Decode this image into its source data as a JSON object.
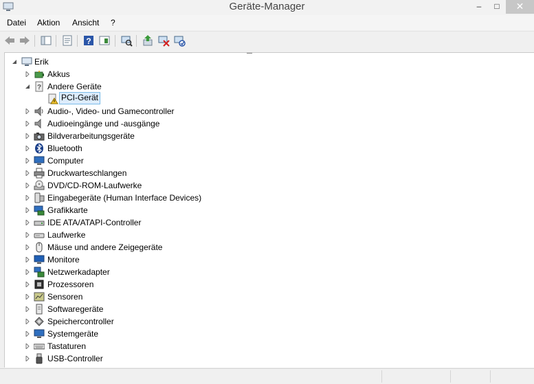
{
  "window": {
    "title": "Geräte-Manager",
    "minimize": "–",
    "maximize": "□",
    "close": "✕"
  },
  "menu": [
    "Datei",
    "Aktion",
    "Ansicht",
    "?"
  ],
  "tree": {
    "root": "Erik",
    "categories": [
      {
        "label": "Akkus",
        "icon": "battery-icon",
        "expanded": false
      },
      {
        "label": "Andere Geräte",
        "icon": "unknown-device-icon",
        "expanded": true,
        "children": [
          {
            "label": "PCI-Gerät",
            "icon": "warning-device-icon",
            "selected": true
          }
        ]
      },
      {
        "label": "Audio-, Video- und Gamecontroller",
        "icon": "speaker-icon",
        "expanded": false
      },
      {
        "label": "Audioeingänge und -ausgänge",
        "icon": "speaker-icon",
        "expanded": false
      },
      {
        "label": "Bildverarbeitungsgeräte",
        "icon": "camera-icon",
        "expanded": false
      },
      {
        "label": "Bluetooth",
        "icon": "bluetooth-icon",
        "expanded": false
      },
      {
        "label": "Computer",
        "icon": "monitor-icon",
        "expanded": false
      },
      {
        "label": "Druckwarteschlangen",
        "icon": "printer-icon",
        "expanded": false
      },
      {
        "label": "DVD/CD-ROM-Laufwerke",
        "icon": "disc-drive-icon",
        "expanded": false
      },
      {
        "label": "Eingabegeräte (Human Interface Devices)",
        "icon": "hid-icon",
        "expanded": false
      },
      {
        "label": "Grafikkarte",
        "icon": "display-adapter-icon",
        "expanded": false
      },
      {
        "label": "IDE ATA/ATAPI-Controller",
        "icon": "ide-controller-icon",
        "expanded": false
      },
      {
        "label": "Laufwerke",
        "icon": "drive-icon",
        "expanded": false
      },
      {
        "label": "Mäuse und andere Zeigegeräte",
        "icon": "mouse-icon",
        "expanded": false
      },
      {
        "label": "Monitore",
        "icon": "monitor-icon",
        "expanded": false
      },
      {
        "label": "Netzwerkadapter",
        "icon": "network-icon",
        "expanded": false
      },
      {
        "label": "Prozessoren",
        "icon": "processor-icon",
        "expanded": false
      },
      {
        "label": "Sensoren",
        "icon": "sensor-icon",
        "expanded": false
      },
      {
        "label": "Softwaregeräte",
        "icon": "software-device-icon",
        "expanded": false
      },
      {
        "label": "Speichercontroller",
        "icon": "storage-controller-icon",
        "expanded": false
      },
      {
        "label": "Systemgeräte",
        "icon": "system-device-icon",
        "expanded": false
      },
      {
        "label": "Tastaturen",
        "icon": "keyboard-icon",
        "expanded": false
      },
      {
        "label": "USB-Controller",
        "icon": "usb-icon",
        "expanded": false
      }
    ]
  },
  "colors": {
    "selection_fill": "#dcecfc",
    "selection_border": "#7cbce8",
    "close_button": "#c7c7c7"
  }
}
